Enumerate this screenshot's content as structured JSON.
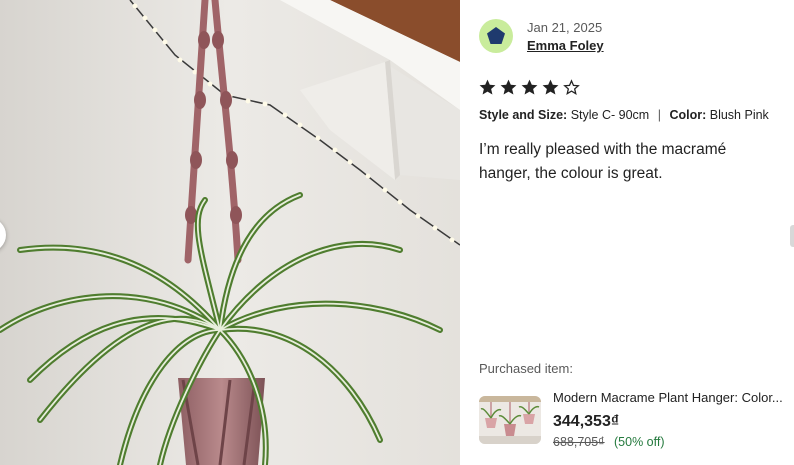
{
  "review": {
    "date": "Jan 21, 2025",
    "reviewer_name": "Emma Foley",
    "rating": 4,
    "rating_max": 5,
    "variation_size_label": "Style and Size:",
    "variation_size_value": "Style C- 90cm",
    "variation_separator": "|",
    "variation_color_label": "Color:",
    "variation_color_value": "Blush Pink",
    "text": "I’m really pleased with the macramé hanger, the colour is great."
  },
  "purchased": {
    "label": "Purchased item:",
    "title": "Modern Macrame Plant Hanger: Color...",
    "price": "344,353₫",
    "original_price": "688,705₫",
    "discount": "(50% off)"
  },
  "colors": {
    "avatar_bg": "#c9ec9c",
    "avatar_shape": "#1f3a6e",
    "star": "#222222",
    "discount_green": "#257a3e"
  },
  "icons": {
    "avatar": "pentagon-avatar-icon",
    "star_filled": "star-filled-icon",
    "star_empty": "star-empty-icon",
    "prev": "chevron-left-icon"
  }
}
